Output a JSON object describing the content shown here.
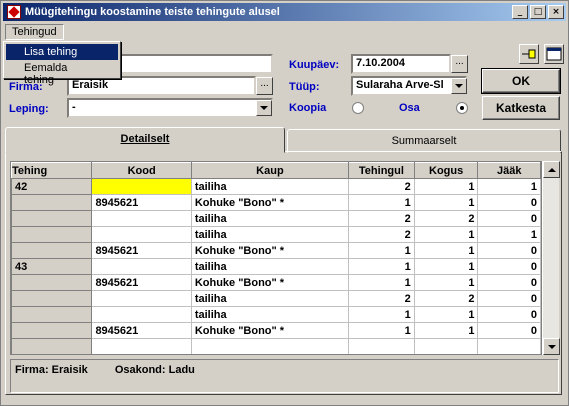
{
  "window": {
    "title": "Müügitehingu koostamine teiste tehingute alusel"
  },
  "menu": {
    "label": "Tehingud",
    "items": [
      "Lisa tehing",
      "Eemalda tehing"
    ]
  },
  "form": {
    "firma_label": "Firma:",
    "firma_value": "Eraisik",
    "leping_label": "Leping:",
    "leping_value": "-",
    "kuupaev_label": "Kuupäev:",
    "kuupaev_value": "7.10.2004",
    "tuup_label": "Tüüp:",
    "tuup_value": "Sularaha Arve-Sl",
    "koopia_label": "Koopia",
    "osa_label": "Osa",
    "ok_label": "OK",
    "katkesta_label": "Katkesta",
    "radio_selected": "Osa"
  },
  "tabs": [
    "Detailselt",
    "Summaarselt"
  ],
  "grid": {
    "columns": [
      "Tehing",
      "Kood",
      "Kaup",
      "Tehingul",
      "Kogus",
      "Jääk"
    ],
    "rows": [
      [
        "42",
        "",
        "tailiha",
        "2",
        "1",
        "1"
      ],
      [
        "",
        "8945621",
        "Kohuke \"Bono\" *",
        "1",
        "1",
        "0"
      ],
      [
        "",
        "",
        "tailiha",
        "2",
        "2",
        "0"
      ],
      [
        "",
        "",
        "tailiha",
        "2",
        "1",
        "1"
      ],
      [
        "",
        "8945621",
        "Kohuke \"Bono\" *",
        "1",
        "1",
        "0"
      ],
      [
        "43",
        "",
        "tailiha",
        "1",
        "1",
        "0"
      ],
      [
        "",
        "8945621",
        "Kohuke \"Bono\" *",
        "1",
        "1",
        "0"
      ],
      [
        "",
        "",
        "tailiha",
        "2",
        "2",
        "0"
      ],
      [
        "",
        "",
        "tailiha",
        "1",
        "1",
        "0"
      ],
      [
        "",
        "8945621",
        "Kohuke \"Bono\" *",
        "1",
        "1",
        "0"
      ],
      [
        "",
        "",
        "",
        "",
        "",
        ""
      ]
    ]
  },
  "status": {
    "firma": "Firma: Eraisik",
    "osakond": "Osakond: Ladu"
  }
}
